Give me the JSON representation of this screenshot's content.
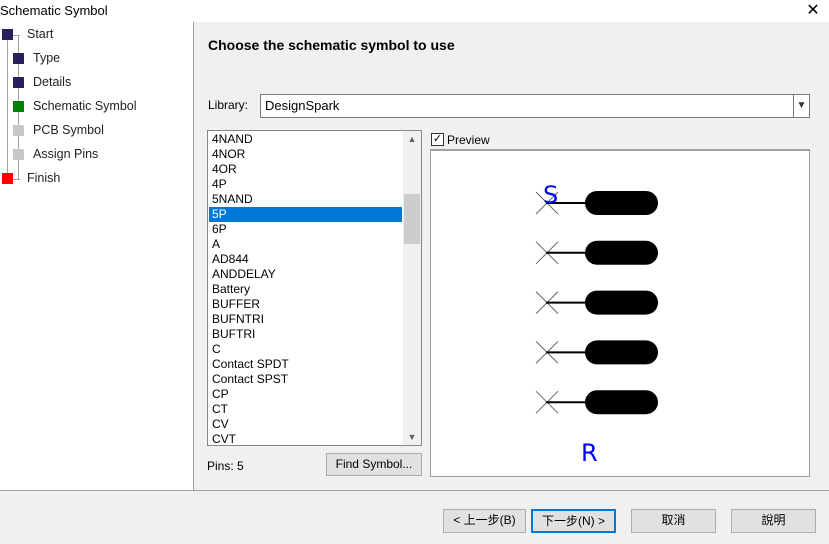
{
  "window": {
    "title": "Schematic Symbol",
    "close_icon": "close-icon"
  },
  "sidebar": {
    "steps": [
      {
        "label": "Start",
        "color": "#2a1f5c"
      },
      {
        "label": "Type",
        "color": "#2a1f5c"
      },
      {
        "label": "Details",
        "color": "#2a1f5c"
      },
      {
        "label": "Schematic Symbol",
        "color": "#008000"
      },
      {
        "label": "PCB Symbol",
        "color": "#c8c8c8"
      },
      {
        "label": "Assign Pins",
        "color": "#c8c8c8"
      },
      {
        "label": "Finish",
        "color": "#ff0000"
      }
    ]
  },
  "main": {
    "heading": "Choose the schematic symbol to use",
    "library_label": "Library:",
    "library_value": "DesignSpark",
    "symbols": [
      "4NAND",
      "4NOR",
      "4OR",
      "4P",
      "5NAND",
      "5P",
      "6P",
      "A",
      "AD844",
      "ANDDELAY",
      "Battery",
      "BUFFER",
      "BUFNTRI",
      "BUFTRI",
      "C",
      "Contact SPDT",
      "Contact SPST",
      "CP",
      "CT",
      "CV",
      "CVT"
    ],
    "selected_symbol": "5P",
    "pins_text": "Pins: 5",
    "find_symbol": "Find Symbol...",
    "preview_label": "Preview",
    "preview_checked": true,
    "preview": {
      "top_label": "S",
      "bottom_label": "R",
      "pin_count": 5,
      "label_color": "#0000ff"
    }
  },
  "footer": {
    "back": "< 上一步(B)",
    "next": "下一步(N) >",
    "cancel": "取消",
    "help": "說明"
  }
}
